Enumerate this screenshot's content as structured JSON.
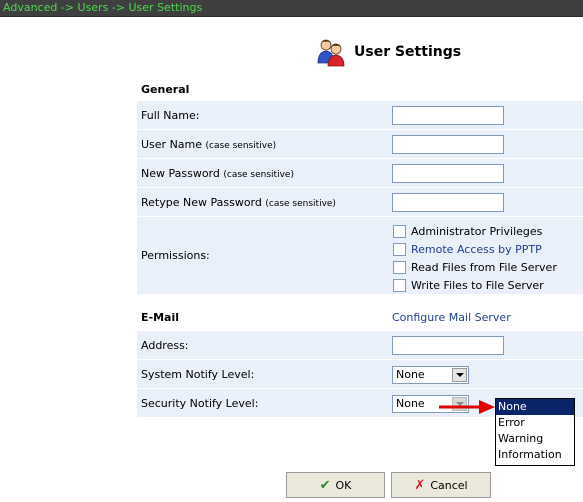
{
  "breadcrumb": "Advanced -> Users -> User Settings",
  "header": {
    "title": "User Settings",
    "icon": "users-icon"
  },
  "general": {
    "section_title": "General",
    "full_name_label": "Full Name:",
    "user_name_label": "User Name",
    "user_name_note": "(case sensitive)",
    "new_password_label": "New Password",
    "new_password_note": "(case sensitive)",
    "retype_password_label": "Retype New Password",
    "retype_password_note": "(case sensitive)",
    "full_name_value": "",
    "user_name_value": "",
    "new_password_value": "",
    "retype_password_value": ""
  },
  "permissions": {
    "label": "Permissions:",
    "items": [
      {
        "label": "Administrator Privileges",
        "checked": false
      },
      {
        "label": "Remote Access by PPTP",
        "checked": false
      },
      {
        "label": "Read Files from File Server",
        "checked": false
      },
      {
        "label": "Write Files to File Server",
        "checked": false
      }
    ]
  },
  "email": {
    "section_title": "E-Mail",
    "configure_link": "Configure Mail Server",
    "address_label": "Address:",
    "address_value": "",
    "system_notify_label": "System Notify Level:",
    "system_notify_value": "None",
    "security_notify_label": "Security Notify Level:",
    "security_notify_value": "None"
  },
  "dropdown": {
    "options": [
      "None",
      "Error",
      "Warning",
      "Information"
    ],
    "selected_index": 0
  },
  "buttons": {
    "ok_label": "OK",
    "cancel_label": "Cancel"
  },
  "colors": {
    "breadcrumb_text": "#4cd84c",
    "row_bg": "#eaf0f9",
    "link": "#1f3f8f",
    "highlight": "#0a246a",
    "pointer_arrow": "#e00000"
  }
}
